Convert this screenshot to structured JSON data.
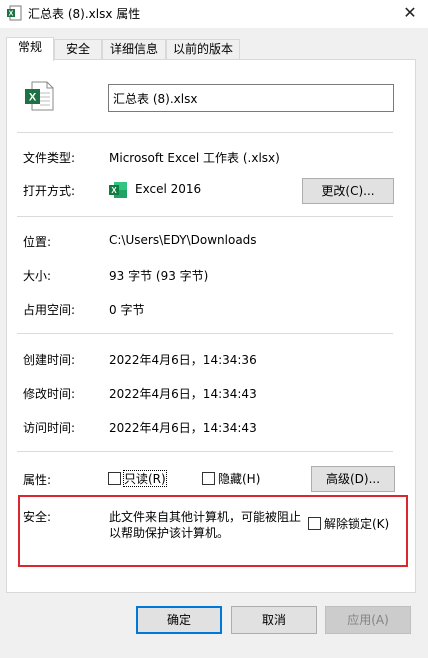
{
  "window": {
    "title": "汇总表 (8).xlsx 属性",
    "close_glyph": "✕"
  },
  "tabs": [
    {
      "label": "常规",
      "active": true
    },
    {
      "label": "安全",
      "active": false
    },
    {
      "label": "详细信息",
      "active": false
    },
    {
      "label": "以前的版本",
      "active": false
    }
  ],
  "general": {
    "file_name": "汇总表 (8).xlsx",
    "file_type_label": "文件类型:",
    "file_type_value": "Microsoft Excel 工作表 (.xlsx)",
    "opens_with_label": "打开方式:",
    "opens_with_value": "Excel 2016",
    "change_button": "更改(C)...",
    "location_label": "位置:",
    "location_value": "C:\\Users\\EDY\\Downloads",
    "size_label": "大小:",
    "size_value": "93 字节 (93 字节)",
    "size_on_disk_label": "占用空间:",
    "size_on_disk_value": "0 字节",
    "created_label": "创建时间:",
    "created_value": "2022年4月6日，14:34:36",
    "modified_label": "修改时间:",
    "modified_value": "2022年4月6日，14:34:43",
    "accessed_label": "访问时间:",
    "accessed_value": "2022年4月6日，14:34:43",
    "attributes_label": "属性:",
    "readonly_label": "只读(R)",
    "hidden_label": "隐藏(H)",
    "advanced_button": "高级(D)...",
    "security_label": "安全:",
    "security_text_line1": "此文件来自其他计算机，可能被阻止",
    "security_text_line2": "以帮助保护该计算机。",
    "unblock_label": "解除锁定(K)"
  },
  "footer": {
    "ok_button": "确定",
    "cancel_button": "取消",
    "apply_button": "应用(A)"
  },
  "colors": {
    "excel_green": "#1e7145",
    "highlight_red": "#d9262f",
    "accent_blue": "#0078d7"
  }
}
